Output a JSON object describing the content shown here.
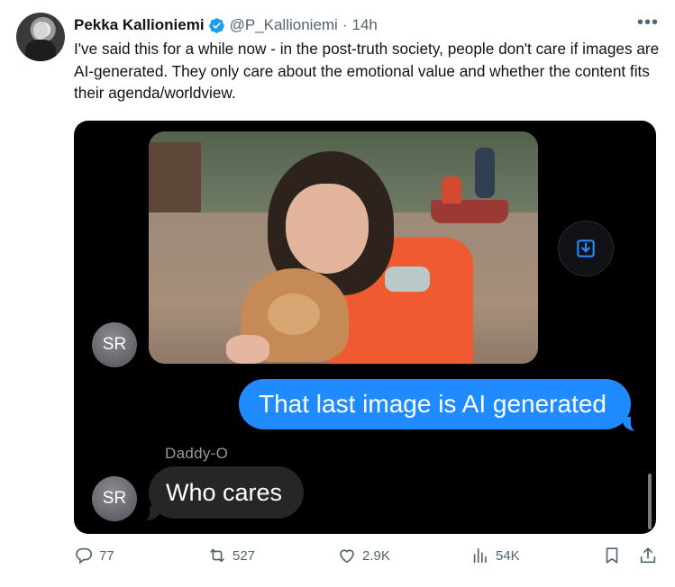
{
  "author": {
    "name": "Pekka Kallioniemi",
    "handle": "@P_Kallioniemi",
    "separator": "·",
    "time": "14h",
    "more_label": "•••"
  },
  "tweet": {
    "text": "I've said this for a while now - in the post-truth society, people don't care if images are AI-generated. They only care about the emotional value and whether the content fits their agenda/worldview."
  },
  "chat": {
    "avatar_initials_1": "SR",
    "avatar_initials_2": "SR",
    "outgoing_message": "That last image is AI generated",
    "sender_name": "Daddy-O",
    "incoming_message": "Who cares"
  },
  "metrics": {
    "replies": "77",
    "retweets": "527",
    "likes": "2.9K",
    "views": "54K"
  },
  "colors": {
    "verified": "#1d9bf0",
    "imessage_blue": "#1f8bff",
    "imessage_gray": "#262628",
    "muted": "#536471"
  },
  "icons": {
    "verified": "verified-badge-icon",
    "more": "more-icon",
    "save": "save-image-icon",
    "reply": "reply-icon",
    "retweet": "retweet-icon",
    "like": "heart-icon",
    "views": "views-chart-icon",
    "bookmark": "bookmark-icon",
    "share": "share-icon"
  }
}
